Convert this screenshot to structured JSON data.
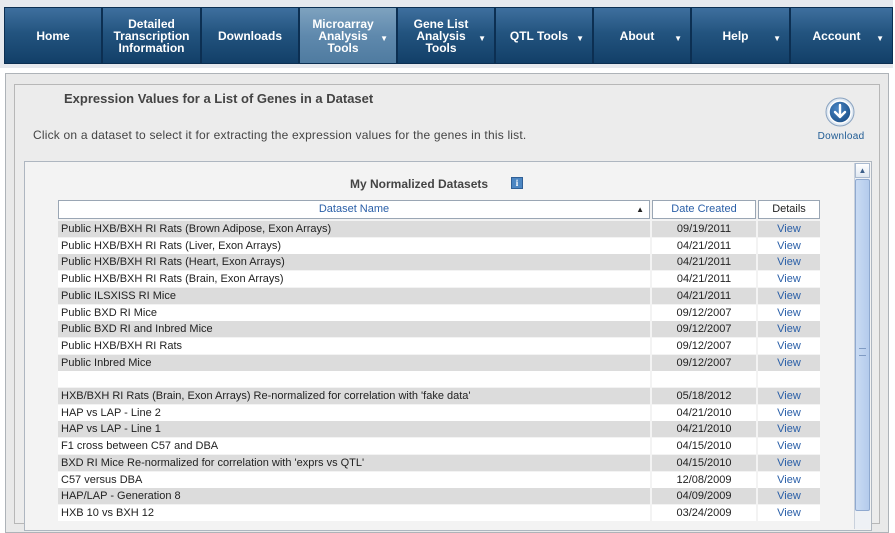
{
  "nav": {
    "items": [
      {
        "label": "Home",
        "dropdown": false,
        "active": false
      },
      {
        "label": "Detailed\nTranscription\nInformation",
        "dropdown": false,
        "active": false
      },
      {
        "label": "Downloads",
        "dropdown": false,
        "active": false
      },
      {
        "label": "Microarray\nAnalysis\nTools",
        "dropdown": true,
        "active": true
      },
      {
        "label": "Gene List\nAnalysis\nTools",
        "dropdown": true,
        "active": false
      },
      {
        "label": "QTL Tools",
        "dropdown": true,
        "active": false
      },
      {
        "label": "About",
        "dropdown": true,
        "active": false
      },
      {
        "label": "Help",
        "dropdown": true,
        "active": false
      },
      {
        "label": "Account",
        "dropdown": true,
        "active": false
      }
    ],
    "dropdown_glyph": "▼"
  },
  "panel": {
    "title": "Expression Values for a List of Genes in a Dataset",
    "instructions": "Click on a dataset to select it for extracting the expression values for the genes in this list.",
    "download_label": "Download",
    "download_icon": "download-arrow-circle-icon"
  },
  "datasets": {
    "title": "My Normalized Datasets",
    "info_glyph": "i",
    "columns": {
      "name": "Dataset Name",
      "date": "Date Created",
      "details": "Details"
    },
    "sort_glyph": "▲",
    "rows": [
      {
        "name": "Public HXB/BXH RI Rats (Brown Adipose, Exon Arrays)",
        "date": "09/19/2011",
        "details": "View"
      },
      {
        "name": "Public HXB/BXH RI Rats (Liver, Exon Arrays)",
        "date": "04/21/2011",
        "details": "View"
      },
      {
        "name": "Public HXB/BXH RI Rats (Heart, Exon Arrays)",
        "date": "04/21/2011",
        "details": "View"
      },
      {
        "name": "Public HXB/BXH RI Rats (Brain, Exon Arrays)",
        "date": "04/21/2011",
        "details": "View"
      },
      {
        "name": "Public ILSXISS RI Mice",
        "date": "04/21/2011",
        "details": "View"
      },
      {
        "name": "Public BXD RI Mice",
        "date": "09/12/2007",
        "details": "View"
      },
      {
        "name": "Public BXD RI and Inbred Mice",
        "date": "09/12/2007",
        "details": "View"
      },
      {
        "name": "Public HXB/BXH RI Rats",
        "date": "09/12/2007",
        "details": "View"
      },
      {
        "name": "Public Inbred Mice",
        "date": "09/12/2007",
        "details": "View"
      },
      {
        "name": "",
        "date": "",
        "details": ""
      },
      {
        "name": "HXB/BXH RI Rats (Brain, Exon Arrays) Re-normalized for correlation with 'fake data'",
        "date": "05/18/2012",
        "details": "View"
      },
      {
        "name": "HAP vs LAP - Line 2",
        "date": "04/21/2010",
        "details": "View"
      },
      {
        "name": "HAP vs LAP - Line 1",
        "date": "04/21/2010",
        "details": "View"
      },
      {
        "name": "F1 cross between C57 and DBA",
        "date": "04/15/2010",
        "details": "View"
      },
      {
        "name": "BXD RI Mice Re-normalized for correlation with 'exprs vs QTL'",
        "date": "04/15/2010",
        "details": "View"
      },
      {
        "name": "C57 versus DBA",
        "date": "12/08/2009",
        "details": "View"
      },
      {
        "name": "HAP/LAP - Generation 8",
        "date": "04/09/2009",
        "details": "View"
      },
      {
        "name": "HXB 10 vs BXH 12",
        "date": "03/24/2009",
        "details": "View"
      }
    ]
  },
  "scrollbar": {
    "up_glyph": "▲"
  },
  "colors": {
    "nav_bg": "#1a4a75",
    "nav_active": "#5f89ad",
    "link": "#2a5fa8",
    "row_shade": "#dcdcdc"
  }
}
